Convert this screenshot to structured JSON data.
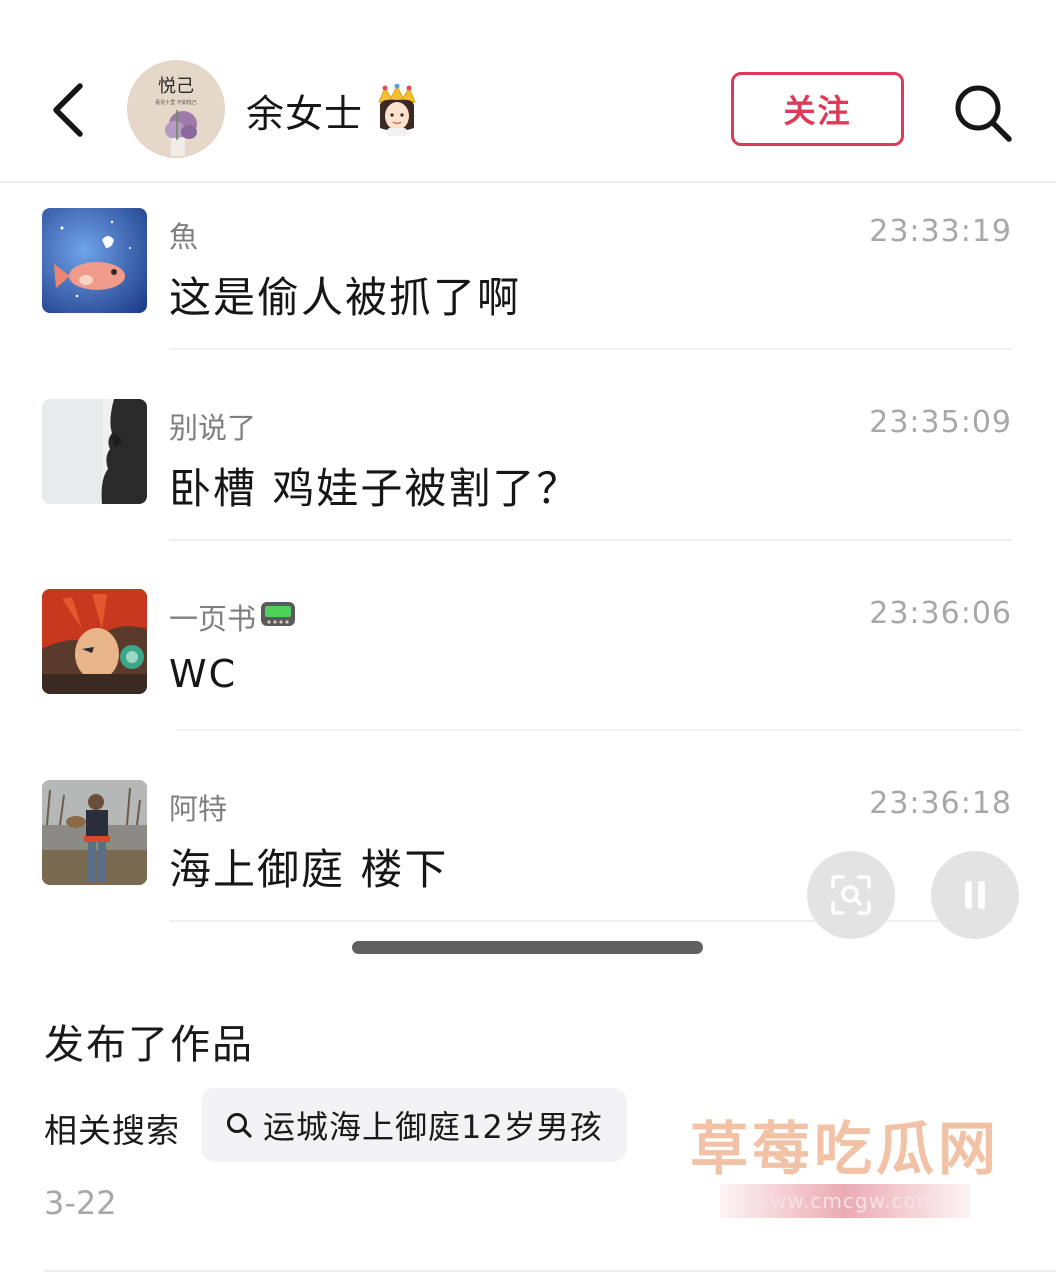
{
  "header": {
    "user_name": "余女士",
    "name_emoji": "crown-woman-emoji",
    "follow_label": "关注",
    "avatar_logo_text": "悦己",
    "avatar_caption": "看花十里 不如悦己"
  },
  "comments": [
    {
      "name": "魚",
      "time": "23:33:19",
      "text": "这是偷人被抓了啊"
    },
    {
      "name": "别说了",
      "time": "23:35:09",
      "text": "卧槽 鸡娃子被割了？"
    },
    {
      "name": "一页书",
      "name_emoji": "pager-icon",
      "time": "23:36:06",
      "text": "WC"
    },
    {
      "name": "阿特",
      "time": "23:36:18",
      "text": "海上御庭 楼下"
    }
  ],
  "post": {
    "published_label": "发布了作品",
    "related_label": "相关搜索",
    "related_query": "运城海上御庭12岁男孩",
    "date": "3-22"
  },
  "watermark": {
    "title": "草莓吃瓜网",
    "url": "www.cmcgw.com"
  },
  "colors": {
    "accent": "#dd3a57",
    "muted_text": "#7f7f7f",
    "time_text": "#a8a8a8"
  }
}
